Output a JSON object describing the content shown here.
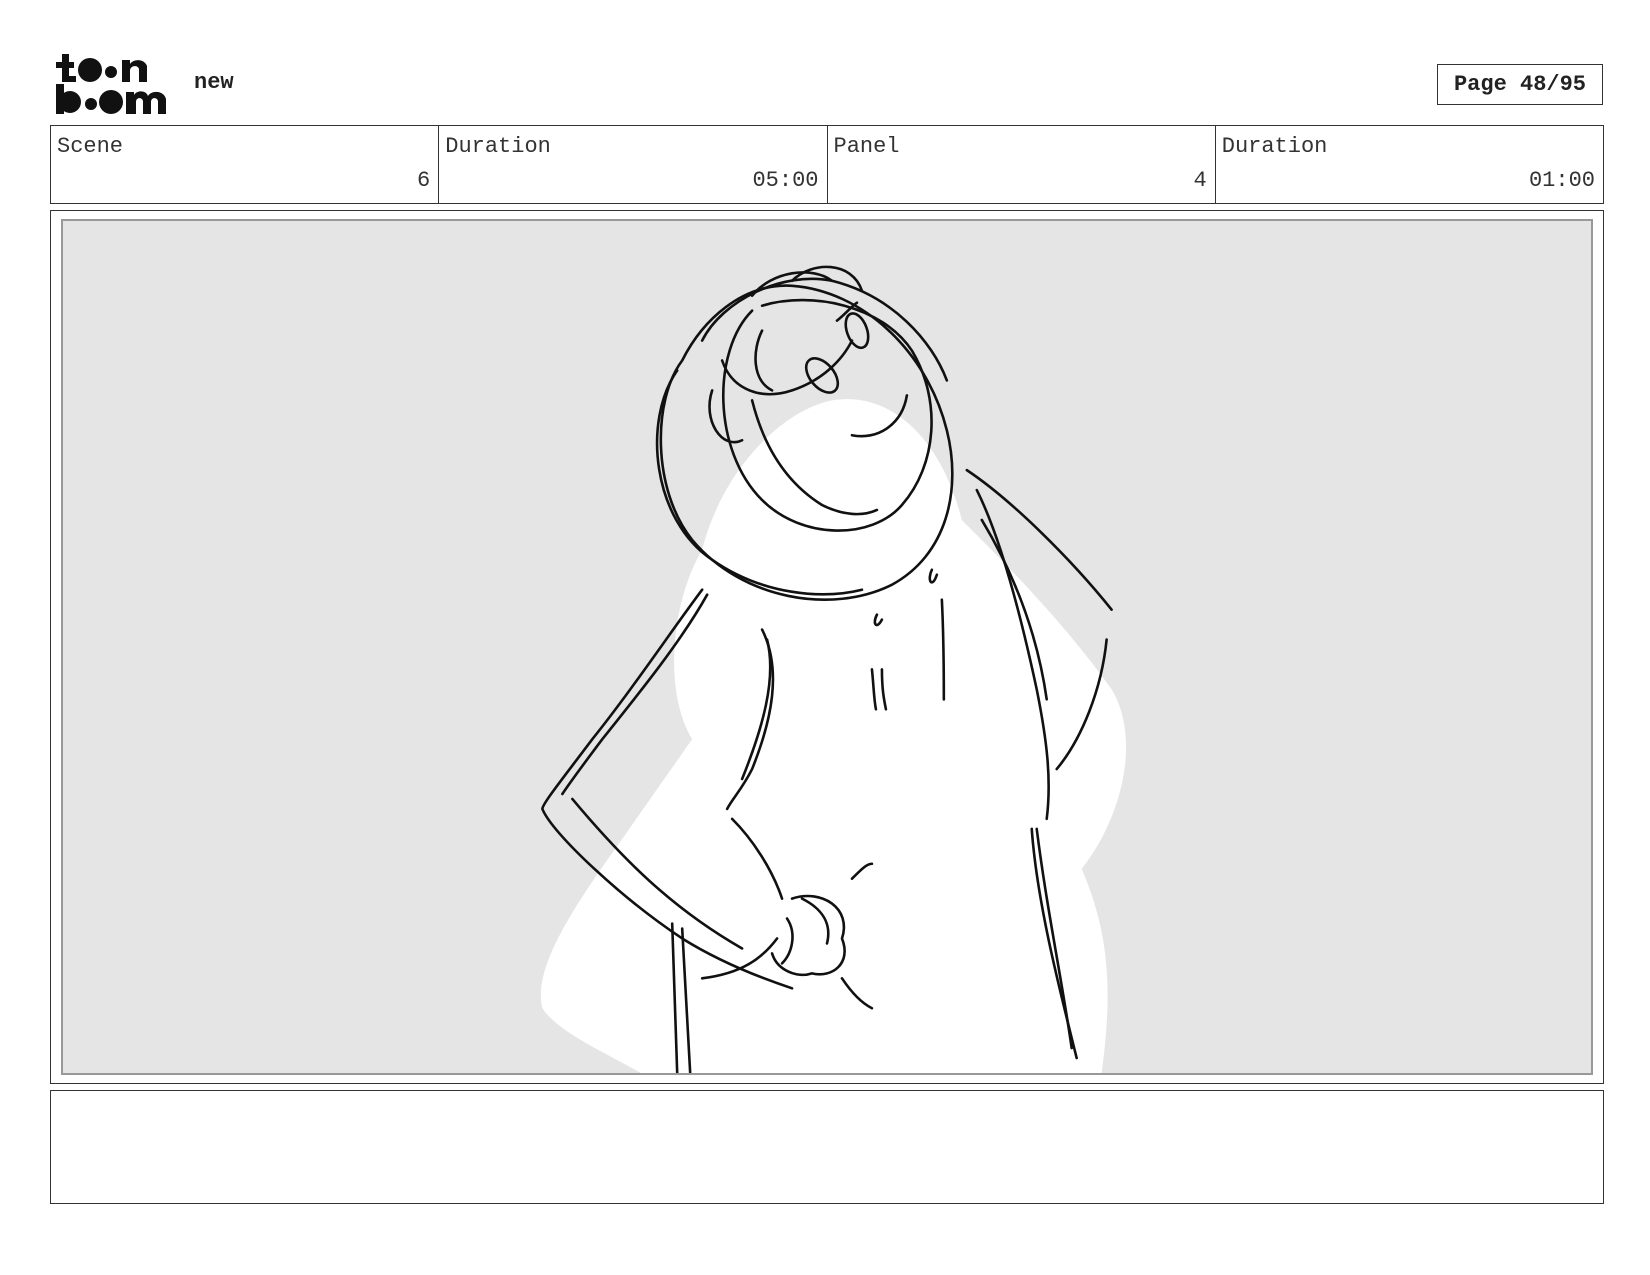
{
  "header": {
    "project_name": "new",
    "page_label": "Page 48/95"
  },
  "info": {
    "scene_label": "Scene",
    "scene_value": "6",
    "scene_duration_label": "Duration",
    "scene_duration_value": "05:00",
    "panel_label": "Panel",
    "panel_value": "4",
    "panel_duration_label": "Duration",
    "panel_duration_value": "01:00"
  },
  "panel": {
    "background_color": "#e5e5e5",
    "sketch_color": "#111111"
  },
  "notes": {
    "text": ""
  }
}
